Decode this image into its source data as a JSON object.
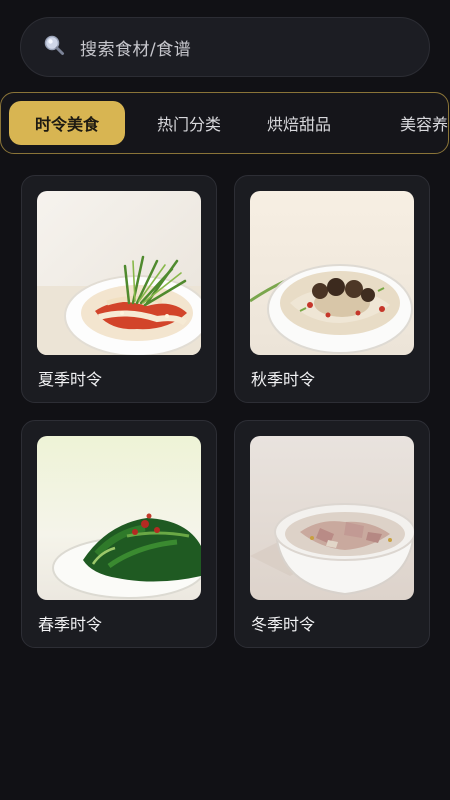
{
  "search": {
    "placeholder": "搜索食材/食谱"
  },
  "tabs": [
    {
      "label": "时令美食",
      "active": true
    },
    {
      "label": "热门分类",
      "active": false
    },
    {
      "label": "烘焙甜品",
      "active": false
    },
    {
      "label": "美容养",
      "active": false
    }
  ],
  "cards": [
    {
      "label": "夏季时令"
    },
    {
      "label": "秋季时令"
    },
    {
      "label": "春季时令"
    },
    {
      "label": "冬季时令"
    }
  ],
  "colors": {
    "background": "#111115",
    "accent": "#d8b552",
    "tab_border": "#8a7438"
  }
}
